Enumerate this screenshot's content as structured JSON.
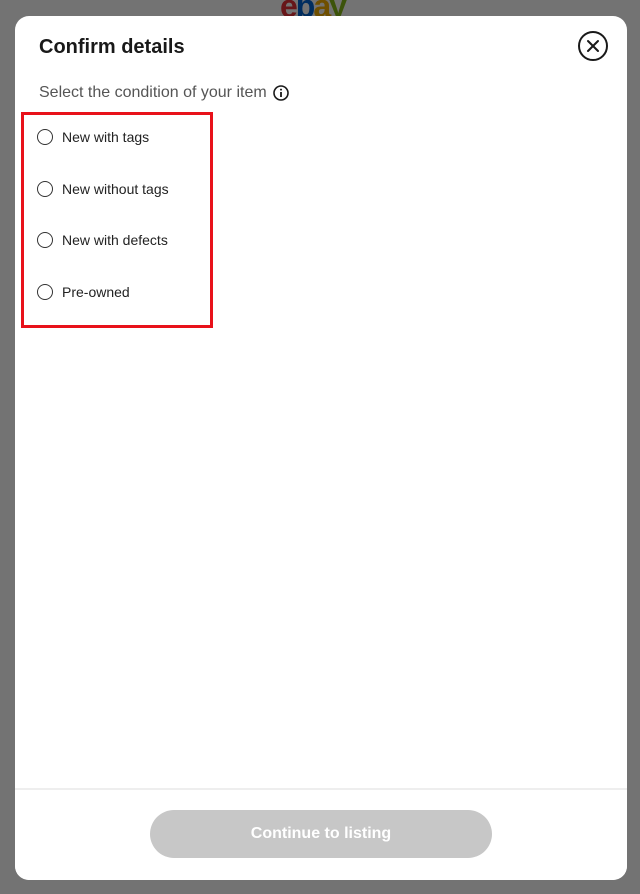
{
  "background": {
    "logo": [
      "e",
      "b",
      "a",
      "y"
    ]
  },
  "modal": {
    "title": "Confirm details",
    "close_icon": "close-icon",
    "subtitle": "Select the condition of your item",
    "info_icon": "info-icon",
    "options": [
      {
        "label": "New with tags",
        "selected": false
      },
      {
        "label": "New without tags",
        "selected": false
      },
      {
        "label": "New with defects",
        "selected": false
      },
      {
        "label": "Pre-owned",
        "selected": false
      }
    ],
    "continue_label": "Continue to listing"
  },
  "colors": {
    "highlight": "#e8111a",
    "button_disabled": "#c7c7c7",
    "overlay": "rgba(0,0,0,0.55)"
  }
}
